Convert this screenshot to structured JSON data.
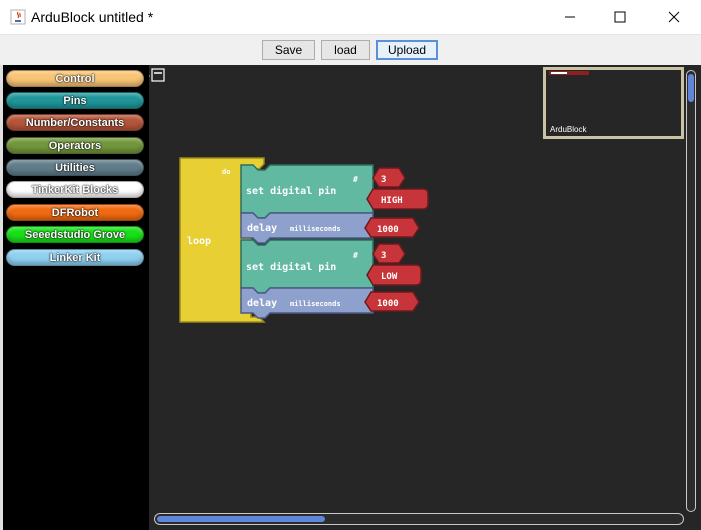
{
  "window": {
    "title": "ArduBlock untitled *"
  },
  "toolbar": {
    "save_label": "Save",
    "load_label": "load",
    "upload_label": "Upload"
  },
  "palette": {
    "items": [
      {
        "label": "Control",
        "color": "#f8c475"
      },
      {
        "label": "Pins",
        "color": "#1e969a"
      },
      {
        "label": "Number/Constants",
        "color": "#b5553a"
      },
      {
        "label": "Operators",
        "color": "#72963c"
      },
      {
        "label": "Utilities",
        "color": "#5f7d8a"
      },
      {
        "label": "TinkerKit Blocks",
        "color": "#ffffff"
      },
      {
        "label": "DFRobot",
        "color": "#f06a10"
      },
      {
        "label": "Seeedstudio Grove",
        "color": "#18e018"
      },
      {
        "label": "Linker Kit",
        "color": "#8ed0f0"
      }
    ]
  },
  "blocks": {
    "loop_label": "loop",
    "do_label": "do",
    "set_pin_1": {
      "label": "set digital pin",
      "hash": "#",
      "pin": "3",
      "value": "HIGH"
    },
    "delay_1": {
      "label": "delay",
      "unit": "milliseconds",
      "value": "1000"
    },
    "set_pin_2": {
      "label": "set digital pin",
      "hash": "#",
      "pin": "3",
      "value": "LOW"
    },
    "delay_2": {
      "label": "delay",
      "unit": "milliseconds",
      "value": "1000"
    }
  },
  "minimap": {
    "label": "ArduBlock"
  },
  "colors": {
    "loop_block": "#e8cf33",
    "set_pin_block": "#62b9a2",
    "delay_block": "#8ea0cc",
    "value_block": "#c7353a",
    "canvas": "#262626"
  }
}
